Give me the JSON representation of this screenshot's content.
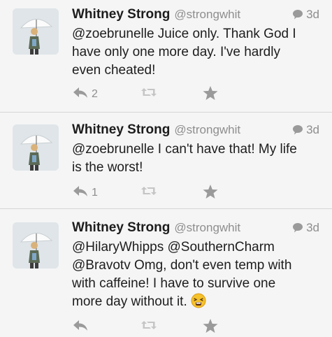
{
  "colors": {
    "background": "#f5f5f5",
    "text": "#1d1d1d",
    "muted": "#8e8e8e",
    "icon": "#9a9a9a",
    "divider": "#d6d6d6"
  },
  "tweets": [
    {
      "name": "Whitney Strong",
      "handle": "@strongwhit",
      "time": "3d",
      "lines": [
        "@zoebrunelle Juice only. Thank God I",
        "have only one more day. I've hardly",
        "even cheated!"
      ],
      "reply_count": "2",
      "icons": [
        "avatar",
        "comment-bubble-icon",
        "reply-icon",
        "retweet-icon",
        "star-icon"
      ]
    },
    {
      "name": "Whitney Strong",
      "handle": "@strongwhit",
      "time": "3d",
      "lines": [
        "@zoebrunelle I can't have that! My life",
        "is the worst!"
      ],
      "reply_count": "1",
      "icons": [
        "avatar",
        "comment-bubble-icon",
        "reply-icon",
        "retweet-icon",
        "star-icon"
      ]
    },
    {
      "name": "Whitney Strong",
      "handle": "@strongwhit",
      "time": "3d",
      "lines": [
        "@HilaryWhipps @SouthernCharm",
        "@Bravotv Omg, don't even temp with",
        "with caffeine! I have to survive one",
        "more day without it."
      ],
      "reply_count": "",
      "icons": [
        "avatar",
        "comment-bubble-icon",
        "reply-icon",
        "retweet-icon",
        "star-icon",
        "tired-face-emoji"
      ]
    }
  ]
}
